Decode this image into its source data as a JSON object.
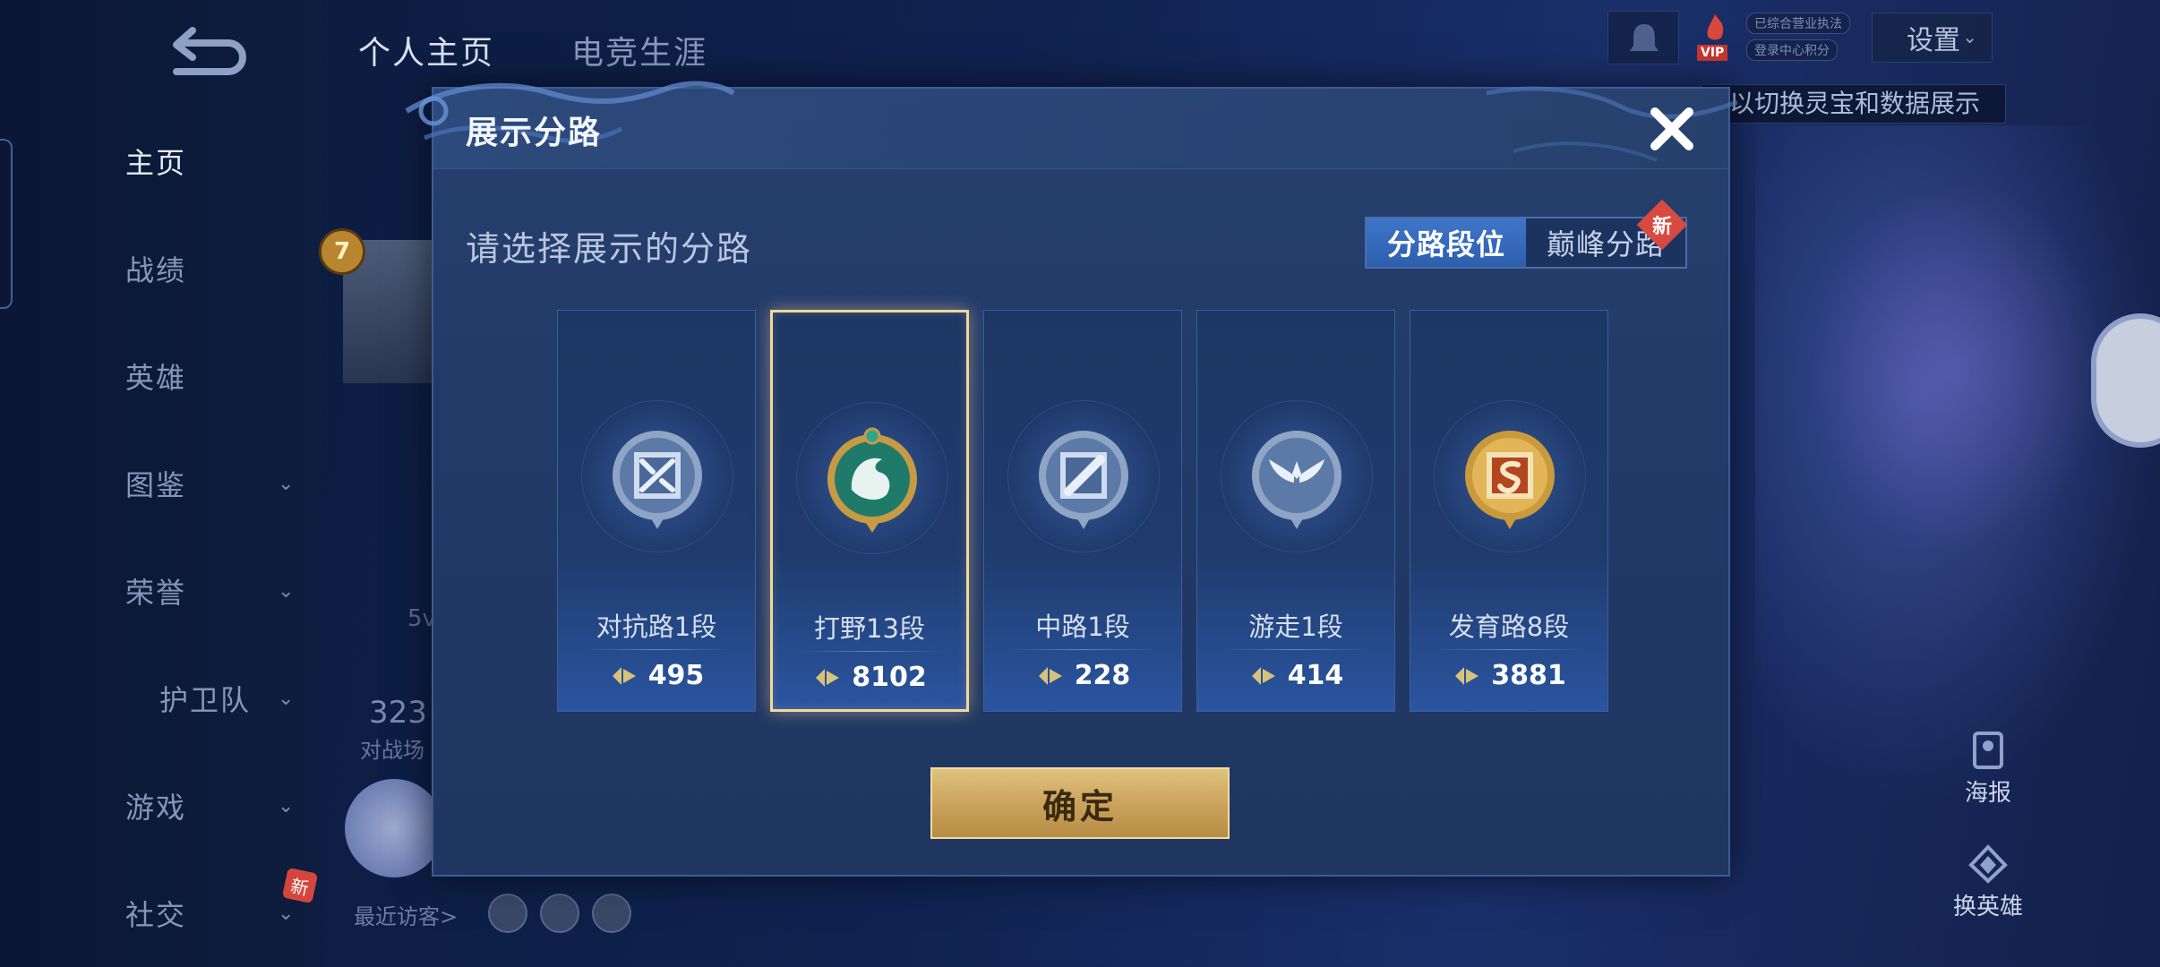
{
  "sidebar": {
    "items": [
      {
        "label": "主页",
        "active": true,
        "has_chevron": false
      },
      {
        "label": "战绩",
        "active": false,
        "has_chevron": false
      },
      {
        "label": "英雄",
        "active": false,
        "has_chevron": false
      },
      {
        "label": "图鉴",
        "active": false,
        "has_chevron": true
      },
      {
        "label": "荣誉",
        "active": false,
        "has_chevron": true
      },
      {
        "label": "护卫队",
        "active": false,
        "has_chevron": true
      },
      {
        "label": "游戏",
        "active": false,
        "has_chevron": true
      },
      {
        "label": "社交",
        "active": false,
        "has_chevron": true
      }
    ],
    "social_badge": "新"
  },
  "header": {
    "tabs": [
      {
        "label": "个人主页",
        "active": true
      },
      {
        "label": "电竞生涯",
        "active": false
      }
    ],
    "vip_label": "VIP",
    "vip_tags": [
      "已综合营业执法",
      "登录中心积分"
    ],
    "settings_label": "设置",
    "hint_text": "以切换灵宝和数据展示"
  },
  "profile_bg": {
    "level": "7",
    "mode_text": "5v",
    "count": "323",
    "count_label": "对战场",
    "recent_visitors_label": "最近访客>"
  },
  "right_actions": [
    {
      "label": "海报",
      "icon": "poster-icon"
    },
    {
      "label": "换英雄",
      "icon": "swap-hero-icon"
    }
  ],
  "dialog": {
    "title": "展示分路",
    "subtitle": "请选择展示的分路",
    "toggle": {
      "options": [
        "分路段位",
        "巅峰分路"
      ],
      "selected_index": 0,
      "new_badge": "新"
    },
    "lanes": [
      {
        "name": "对抗路1段",
        "score": "495",
        "icon": "clash-lane-icon",
        "selected": false
      },
      {
        "name": "打野13段",
        "score": "8102",
        "icon": "jungle-dragon-icon",
        "selected": true
      },
      {
        "name": "中路1段",
        "score": "228",
        "icon": "mid-lane-icon",
        "selected": false
      },
      {
        "name": "游走1段",
        "score": "414",
        "icon": "roam-wings-icon",
        "selected": false
      },
      {
        "name": "发育路8段",
        "score": "3881",
        "icon": "farm-lane-icon",
        "selected": false
      }
    ],
    "confirm_label": "确定"
  },
  "colors": {
    "dialog_bg": "#223a68",
    "selected_border": "#f1d79a",
    "toggle_active": "#3f75c8",
    "confirm_gold": "#c9a15a",
    "badge_red": "#d84a3f"
  }
}
